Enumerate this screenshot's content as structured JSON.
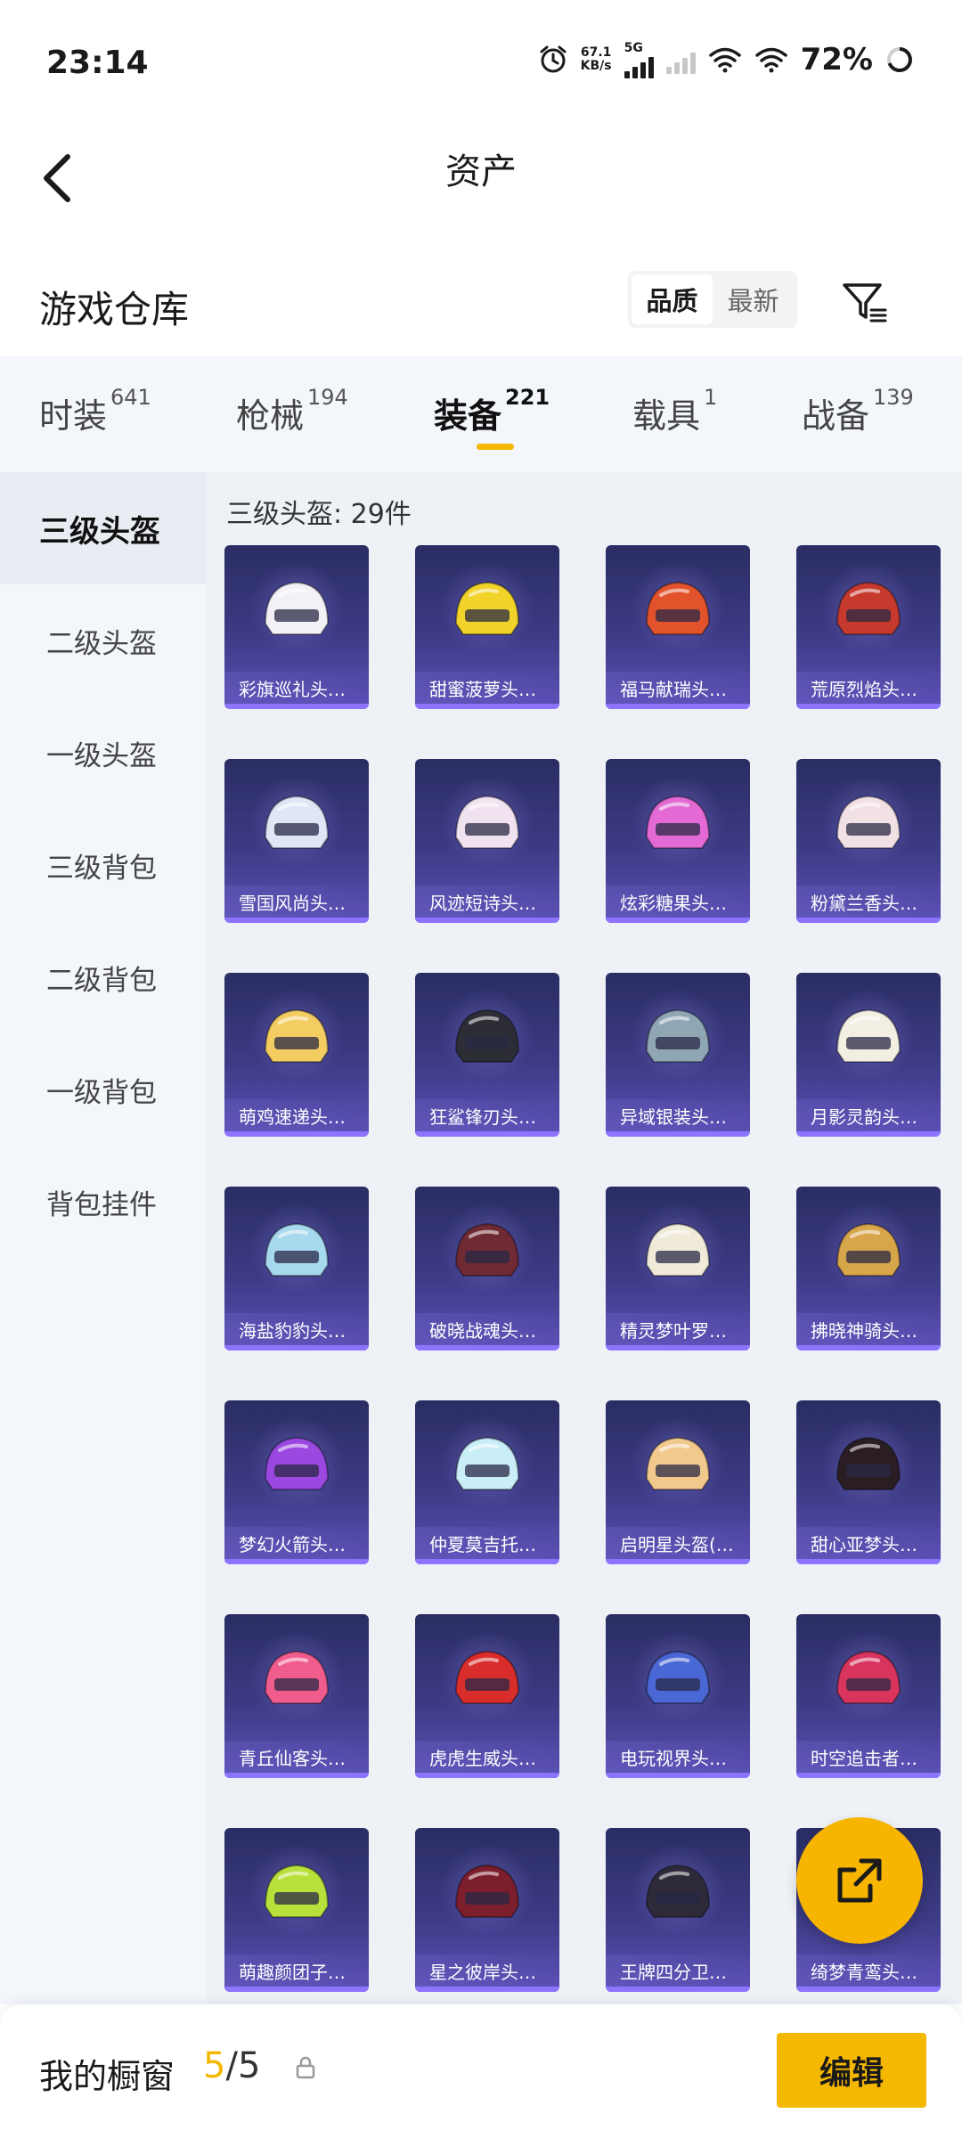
{
  "status_bar": {
    "time": "23:14",
    "net_speed_value": "67.1",
    "net_speed_unit": "KB/s",
    "network_type": "5G",
    "battery": "72%"
  },
  "header": {
    "title": "资产"
  },
  "warehouse": {
    "title": "游戏仓库",
    "sort_options": [
      "品质",
      "最新"
    ],
    "selected_sort": "品质"
  },
  "categories": [
    {
      "label": "时装",
      "count": "641"
    },
    {
      "label": "枪械",
      "count": "194"
    },
    {
      "label": "装备",
      "count": "221"
    },
    {
      "label": "载具",
      "count": "1"
    },
    {
      "label": "战备",
      "count": "139"
    }
  ],
  "active_category": "装备",
  "sidebar": {
    "items": [
      {
        "label": "三级头盔"
      },
      {
        "label": "二级头盔"
      },
      {
        "label": "一级头盔"
      },
      {
        "label": "三级背包"
      },
      {
        "label": "二级背包"
      },
      {
        "label": "一级背包"
      },
      {
        "label": "背包挂件"
      }
    ],
    "active": "三级头盔"
  },
  "content": {
    "count_label": "三级头盔: 29件",
    "items": [
      {
        "name": "彩旗巡礼头…",
        "color": "#f3f1f6"
      },
      {
        "name": "甜蜜菠萝头…",
        "color": "#f2d32a"
      },
      {
        "name": "福马献瑞头…",
        "color": "#e2532c"
      },
      {
        "name": "荒原烈焰头…",
        "color": "#c6392d"
      },
      {
        "name": "雪国风尚头…",
        "color": "#dfe7f6"
      },
      {
        "name": "风迹短诗头…",
        "color": "#f0e3ef"
      },
      {
        "name": "炫彩糖果头…",
        "color": "#e36ad4"
      },
      {
        "name": "粉黛兰香头…",
        "color": "#f1e1e4"
      },
      {
        "name": "萌鸡速递头…",
        "color": "#f4cd62"
      },
      {
        "name": "狂鲨锋刃头…",
        "color": "#2d2d35"
      },
      {
        "name": "异域银装头…",
        "color": "#8fa6b5"
      },
      {
        "name": "月影灵韵头…",
        "color": "#f3eee2"
      },
      {
        "name": "海盐豹豹头…",
        "color": "#a6d8ee"
      },
      {
        "name": "破晓战魂头…",
        "color": "#702a33"
      },
      {
        "name": "精灵梦叶罗…",
        "color": "#f0ead9"
      },
      {
        "name": "拂晓神骑头…",
        "color": "#d7a54a"
      },
      {
        "name": "梦幻火箭头…",
        "color": "#9a48e0"
      },
      {
        "name": "仲夏莫吉托…",
        "color": "#c9eef8"
      },
      {
        "name": "启明星头盔(…",
        "color": "#f1c98d"
      },
      {
        "name": "甜心亚梦头…",
        "color": "#2b1d24"
      },
      {
        "name": "青丘仙客头…",
        "color": "#f05c8c"
      },
      {
        "name": "虎虎生威头…",
        "color": "#d92d2c"
      },
      {
        "name": "电玩视界头…",
        "color": "#4a67d6"
      },
      {
        "name": "时空追击者…",
        "color": "#d8345d"
      },
      {
        "name": "萌趣颜团子…",
        "color": "#b8e03a"
      },
      {
        "name": "星之彼岸头…",
        "color": "#7d1e2c"
      },
      {
        "name": "王牌四分卫…",
        "color": "#2f2a3a"
      },
      {
        "name": "绮梦青鸾头…",
        "color": "#e6d6f3"
      }
    ]
  },
  "bottom_bar": {
    "label": "我的橱窗",
    "used": "5",
    "separator": "/",
    "total": "5",
    "edit_label": "编辑"
  },
  "colors": {
    "accent": "#f5b800",
    "card_top": "#2a2d63",
    "card_bottom": "#5b50b7",
    "sidebar_bg": "#f3f6fb",
    "content_bg": "#eef2f7"
  }
}
